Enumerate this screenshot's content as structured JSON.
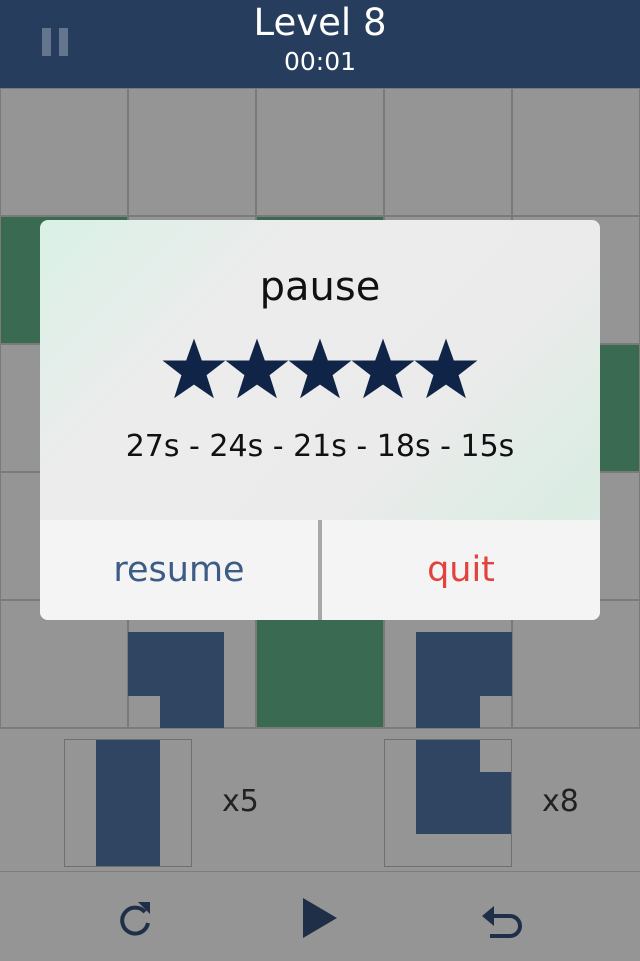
{
  "header": {
    "title": "Level 8",
    "timer": "00:01"
  },
  "board": {
    "rows": 5,
    "cols": 5,
    "cells": [
      [
        "gray",
        "gray",
        "gray",
        "gray",
        "gray"
      ],
      [
        "green",
        "gray",
        "green",
        "gray",
        "gray"
      ],
      [
        "gray",
        "gray",
        "gray",
        "gray",
        "green"
      ],
      [
        "gray",
        "gray",
        "gray",
        "gray",
        "gray"
      ],
      [
        "gray",
        "gray",
        "green",
        "gray",
        "gray"
      ]
    ]
  },
  "tray": {
    "pieces": [
      {
        "shape": "vertical-bar",
        "count": "x5"
      },
      {
        "shape": "l-shape",
        "count": "x8"
      }
    ]
  },
  "toolbar": {
    "buttons": [
      {
        "icon": "redo-icon"
      },
      {
        "icon": "play-icon"
      },
      {
        "icon": "undo-icon"
      }
    ]
  },
  "dialog": {
    "title": "pause",
    "stars_filled": 5,
    "stars_total": 5,
    "times": "27s - 24s - 21s - 18s - 15s",
    "resume_label": "resume",
    "quit_label": "quit"
  },
  "colors": {
    "header": "#263d5e",
    "green": "#3a6a51",
    "piece": "#2f4561",
    "star": "#0f2446",
    "resume": "#3c5c86",
    "quit": "#e2423b"
  }
}
